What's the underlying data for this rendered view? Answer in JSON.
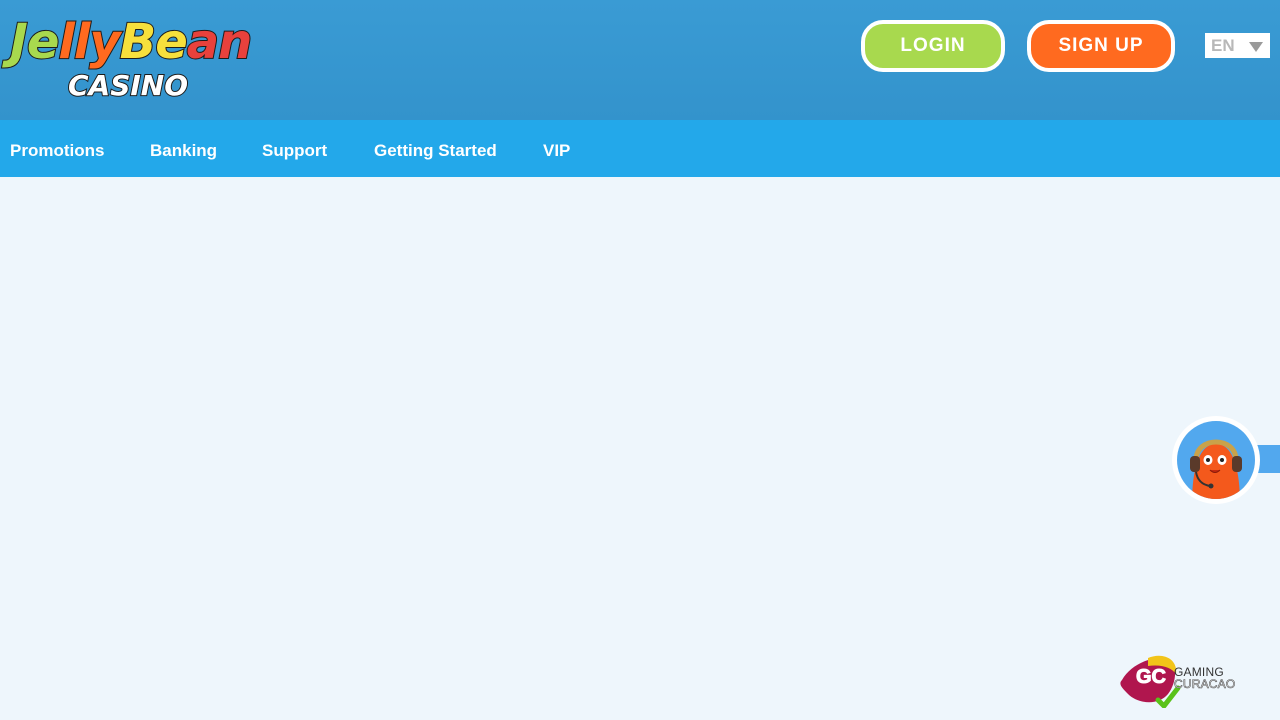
{
  "header": {
    "logo": {
      "letters": [
        {
          "char": "J",
          "color": "#a8d94e"
        },
        {
          "char": "e",
          "color": "#a8d94e"
        },
        {
          "char": "l",
          "color": "#ff6a1f"
        },
        {
          "char": "l",
          "color": "#ff6a1f"
        },
        {
          "char": "y",
          "color": "#ff6a1f"
        },
        {
          "char": "B",
          "color": "#f7e03c"
        },
        {
          "char": "e",
          "color": "#f7e03c"
        },
        {
          "char": "a",
          "color": "#e8413c"
        },
        {
          "char": "n",
          "color": "#e8413c"
        }
      ],
      "subtitle": "CASINO"
    },
    "login_label": "LOGIN",
    "signup_label": "SIGN UP",
    "language": "EN"
  },
  "nav": {
    "items": [
      {
        "label": "Promotions"
      },
      {
        "label": "Banking"
      },
      {
        "label": "Support"
      },
      {
        "label": "Getting Started"
      },
      {
        "label": "VIP"
      }
    ]
  },
  "license": {
    "mark": "GC",
    "line1": "GAMING",
    "line2": "CURACAO"
  },
  "colors": {
    "header_bg": "#3393cc",
    "nav_bg": "#23a8ea",
    "page_bg": "#eef6fc",
    "login": "#a8d94e",
    "signup": "#ff6a1f"
  }
}
